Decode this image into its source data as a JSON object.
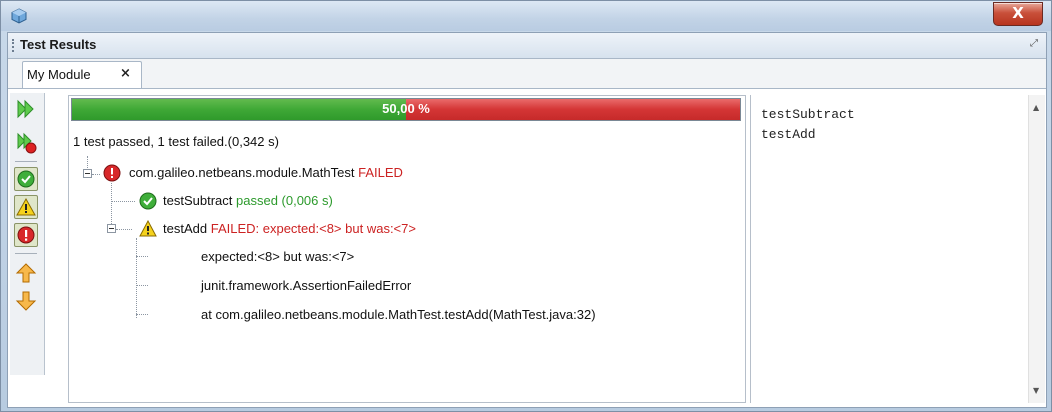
{
  "window": {
    "close_label": "X"
  },
  "panel": {
    "title": "Test Results",
    "maximize_icon": "restore-icon"
  },
  "tabs": [
    {
      "label": "My Module",
      "close": "×"
    }
  ],
  "toolbar": {
    "buttons": [
      "rerun-icon",
      "rerun-failed-icon",
      "show-passed-icon",
      "show-warnings-icon",
      "show-failures-icon",
      "previous-failure-icon",
      "next-failure-icon"
    ]
  },
  "progress": {
    "percent": 50,
    "label": "50,00 %"
  },
  "results": {
    "summary": "1 test passed, 1 test failed.(0,342 s)",
    "suite": {
      "name": "com.galileo.netbeans.module.MathTest",
      "status": "FAILED"
    },
    "tests": [
      {
        "name": "testSubtract",
        "status": "passed  (0,006 s)"
      },
      {
        "name": "testAdd",
        "status": "FAILED: expected:<8> but was:<7>"
      }
    ],
    "details": [
      "expected:<8> but was:<7>",
      "junit.framework.AssertionFailedError",
      "at com.galileo.netbeans.module.MathTest.testAdd(MathTest.java:32)"
    ]
  },
  "output": {
    "lines": [
      "testSubtract",
      "testAdd"
    ]
  },
  "colors": {
    "pass": "#2c9a2c",
    "fail": "#cc2222"
  }
}
